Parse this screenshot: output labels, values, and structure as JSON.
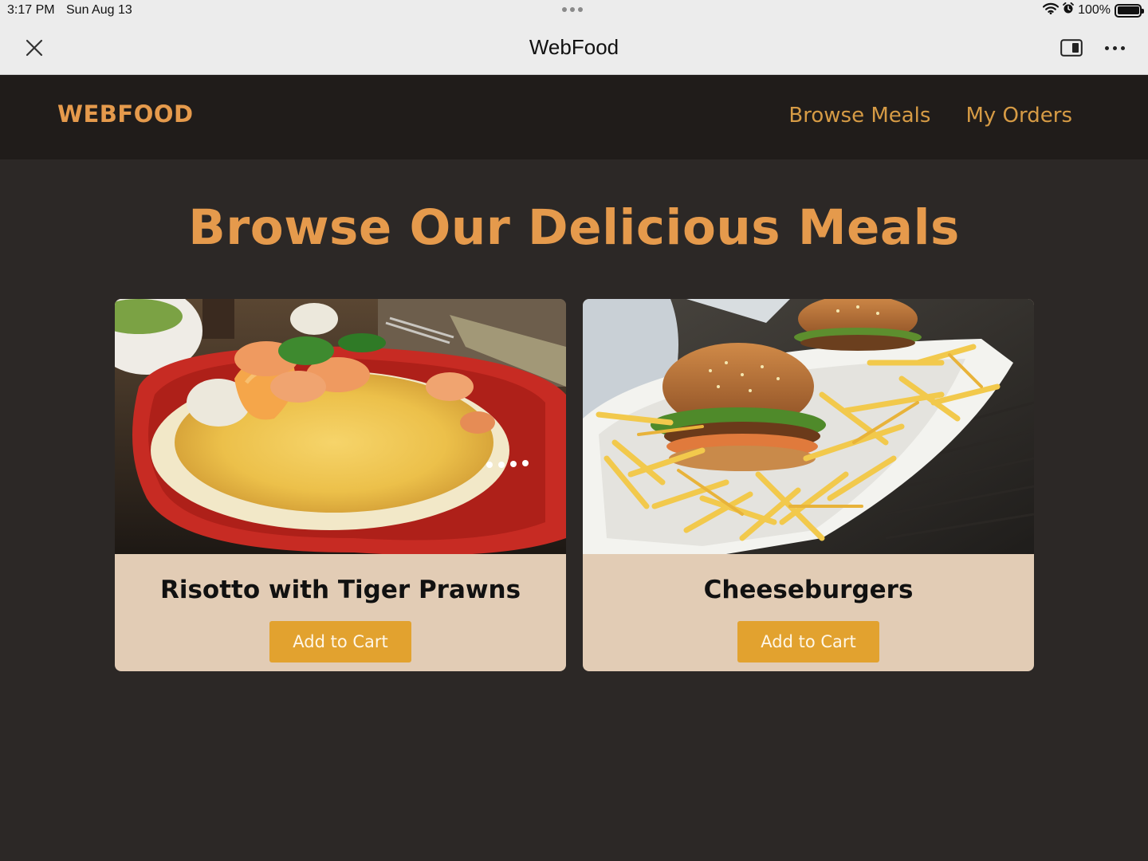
{
  "status_bar": {
    "time": "3:17 PM",
    "date": "Sun Aug 13",
    "battery": "100%",
    "battery_level": 1.0,
    "icons": [
      "wifi-icon",
      "alarm-icon",
      "battery-icon"
    ]
  },
  "browser": {
    "title": "WebFood",
    "icons": [
      "close-icon",
      "split-view-icon",
      "more-icon"
    ]
  },
  "header": {
    "logo": "WEBFOOD",
    "nav": [
      "Browse Meals",
      "My Orders"
    ]
  },
  "main": {
    "heading": "Browse Our Delicious Meals",
    "meals": [
      {
        "name": "Risotto with Tiger Prawns",
        "button": "Add to Cart",
        "image": "risotto-photo"
      },
      {
        "name": "Cheeseburgers",
        "button": "Add to Cart",
        "image": "cheeseburgers-photo"
      }
    ]
  },
  "colors": {
    "page_background": "#2c2826",
    "header_background": "#201c1a",
    "accent": "#e59a4c",
    "nav_link": "#d69b45",
    "card_background": "#e2ccb5",
    "button": "#e2a22f"
  }
}
